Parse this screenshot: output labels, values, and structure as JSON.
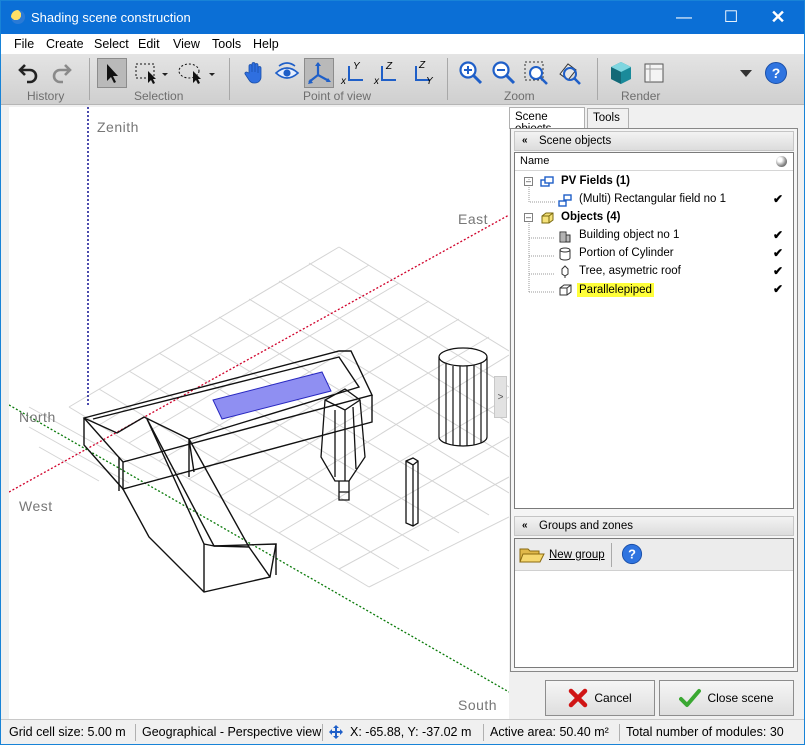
{
  "window": {
    "title": "Shading scene construction"
  },
  "menu": [
    "File",
    "Create",
    "Select",
    "Edit",
    "View",
    "Tools",
    "Help"
  ],
  "toolbar": {
    "groups": {
      "history": "History",
      "selection": "Selection",
      "point_of_view": "Point of view",
      "zoom": "Zoom",
      "render": "Render"
    },
    "axis_buttons": [
      "X",
      "Y",
      "Z"
    ]
  },
  "viewport": {
    "labels": {
      "zenith": "Zenith",
      "east": "East",
      "north": "North",
      "west": "West",
      "south": "South"
    },
    "handle": ">"
  },
  "panel": {
    "tabs": [
      "Scene objects",
      "Tools"
    ],
    "scene_section": "Scene objects",
    "column_name": "Name",
    "tree": {
      "pv_fields": "PV Fields (1)",
      "pv_field_item": "(Multi) Rectangular field no 1",
      "objects": "Objects (4)",
      "object_items": [
        "Building object no 1",
        "Portion of Cylinder",
        "Tree, asymetric roof",
        "Parallelepiped"
      ],
      "check": "✔"
    },
    "groups_section": "Groups and zones",
    "new_group": "New group"
  },
  "buttons": {
    "cancel": "Cancel",
    "close_scene": "Close scene"
  },
  "status": {
    "grid_cell": "Grid cell size:  5.00 m",
    "view_mode": "Geographical - Perspective view",
    "coords": "X: -65.88, Y: -37.02 m",
    "active_area": "Active area: 50.40 m²",
    "modules": "Total number of modules: 30"
  },
  "colors": {
    "titlebar": "#0b6fd6",
    "pv_field": "#7f86f0",
    "highlight": "#ffff3a",
    "north_axis": "#0a7a0a",
    "east_axis": "#d0002a",
    "zenith_axis": "#00008b"
  }
}
